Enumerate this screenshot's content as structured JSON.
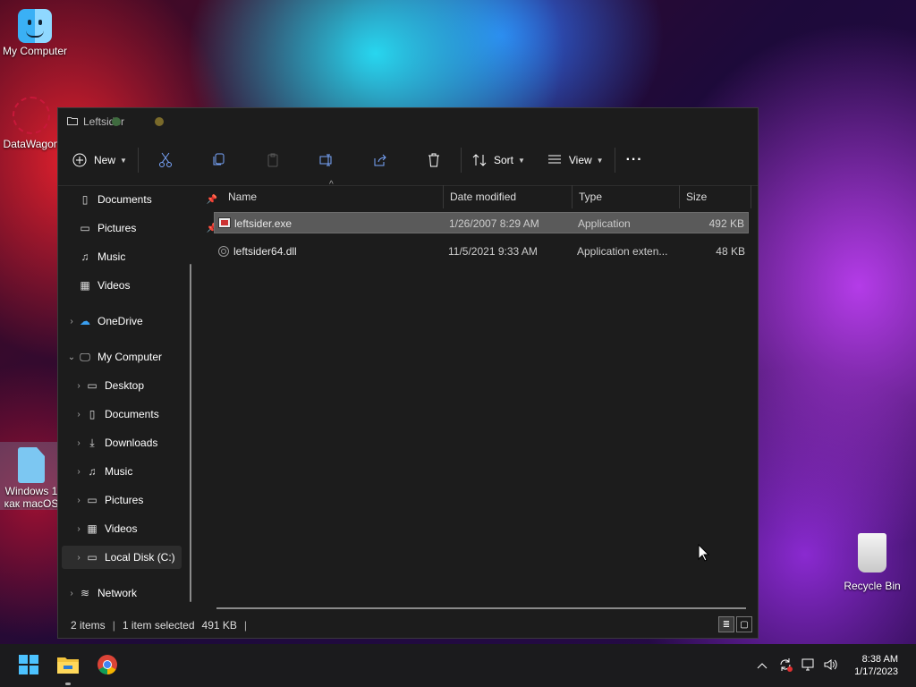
{
  "desktop": {
    "icons": [
      {
        "label": "My Computer"
      },
      {
        "label": "DataWagon"
      },
      {
        "label": "Windows 1\nкак macOS"
      },
      {
        "label": "Recycle Bin"
      }
    ]
  },
  "window": {
    "title": "Leftsider",
    "toolbar": {
      "new_label": "New",
      "sort_label": "Sort",
      "view_label": "View",
      "more_label": "···",
      "icons": [
        "cut-icon",
        "copy-icon",
        "paste-icon",
        "rename-icon",
        "share-icon",
        "delete-icon"
      ]
    },
    "nav": {
      "items": [
        {
          "label": "Documents",
          "icon": "document-icon",
          "pinned": true
        },
        {
          "label": "Pictures",
          "icon": "picture-icon",
          "pinned": true
        },
        {
          "label": "Music",
          "icon": "music-icon"
        },
        {
          "label": "Videos",
          "icon": "video-icon"
        },
        {
          "label": "OneDrive",
          "icon": "cloud-icon"
        },
        {
          "label": "My Computer",
          "icon": "computer-icon",
          "expanded": true
        },
        {
          "label": "Desktop",
          "icon": "desktop-icon"
        },
        {
          "label": "Documents",
          "icon": "document-icon"
        },
        {
          "label": "Downloads",
          "icon": "download-icon"
        },
        {
          "label": "Music",
          "icon": "music-icon"
        },
        {
          "label": "Pictures",
          "icon": "picture-icon"
        },
        {
          "label": "Videos",
          "icon": "video-icon"
        },
        {
          "label": "Local Disk (C:)",
          "icon": "drive-icon",
          "selected": true
        },
        {
          "label": "Network",
          "icon": "network-icon"
        }
      ]
    },
    "columns": [
      "Name",
      "Date modified",
      "Type",
      "Size"
    ],
    "files": [
      {
        "name": "leftsider.exe",
        "date": "1/26/2007 8:29 AM",
        "type": "Application",
        "size": "492 KB",
        "selected": true
      },
      {
        "name": "leftsider64.dll",
        "date": "11/5/2021 9:33 AM",
        "type": "Application exten...",
        "size": "48 KB",
        "selected": false
      }
    ],
    "status": {
      "items": "2 items",
      "selected": "1 item selected",
      "size": "491 KB"
    }
  },
  "taskbar": {
    "apps": [
      "start-icon",
      "file-explorer-icon",
      "chrome-icon"
    ],
    "time": "8:38 AM",
    "date": "1/17/2023"
  }
}
